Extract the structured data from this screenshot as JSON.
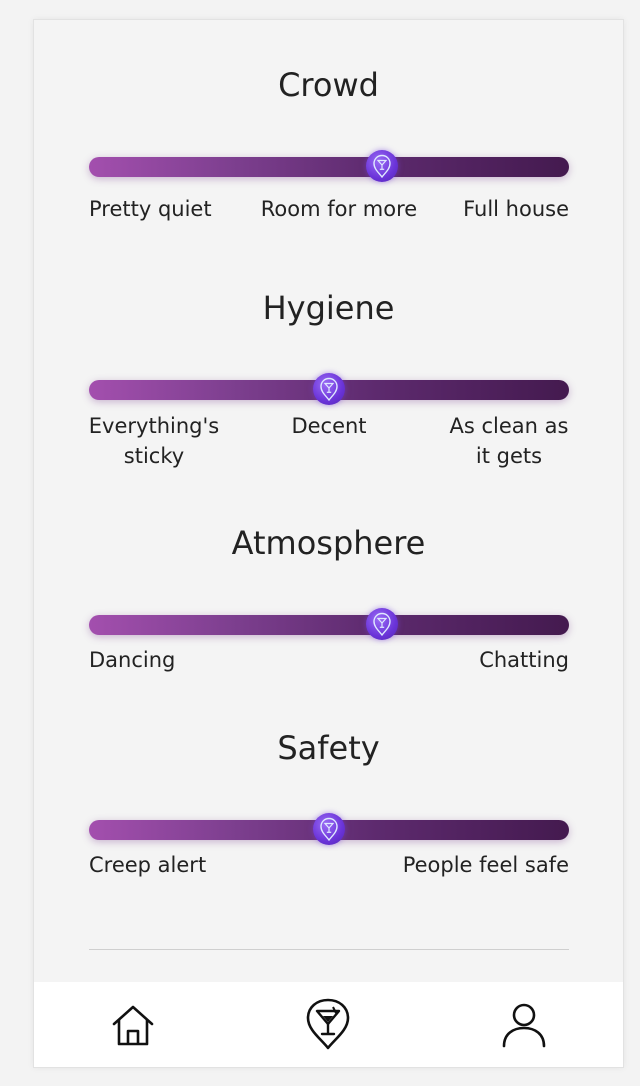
{
  "sections": [
    {
      "title": "Crowd",
      "value_fraction": 0.61,
      "labels": [
        "Pretty quiet",
        "Room for more",
        "Full house"
      ]
    },
    {
      "title": "Hygiene",
      "value_fraction": 0.5,
      "labels": [
        "Everything's sticky",
        "Decent",
        "As clean as it gets"
      ],
      "label_lines": [
        [
          "Everything's",
          "sticky"
        ],
        [
          "Decent"
        ],
        [
          "As clean as",
          "it gets"
        ]
      ]
    },
    {
      "title": "Atmosphere",
      "value_fraction": 0.61,
      "labels": [
        "Dancing",
        "Chatting"
      ]
    },
    {
      "title": "Safety",
      "value_fraction": 0.5,
      "labels": [
        "Creep alert",
        "People feel safe"
      ]
    }
  ],
  "colors": {
    "track_start": "#a34fae",
    "track_end": "#441a4f",
    "thumb": "#6a33d8"
  },
  "nav": {
    "items": [
      {
        "icon": "home-icon"
      },
      {
        "icon": "cocktail-pin-icon"
      },
      {
        "icon": "user-icon"
      }
    ]
  }
}
